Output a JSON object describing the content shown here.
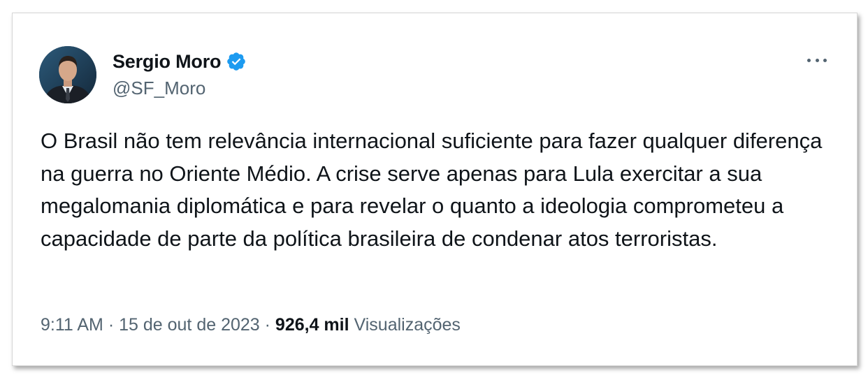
{
  "author": {
    "display_name": "Sergio Moro",
    "handle": "@SF_Moro",
    "verified": true,
    "avatar_icon": "profile-photo"
  },
  "more_icon": "more-options-icon",
  "tweet": {
    "text": "O Brasil não tem relevância internacional suficiente para fazer qualquer diferença na guerra no Oriente Médio. A crise serve apenas para Lula exercitar a sua megalomania diplomática e para revelar o quanto a ideologia comprometeu a capacidade de parte da política brasileira de condenar atos terroristas."
  },
  "meta": {
    "time": "9:11 AM",
    "separator": "·",
    "date": "15 de out de 2023",
    "views_count": "926,4 mil",
    "views_label": "Visualizações"
  },
  "colors": {
    "text_primary": "#0f1419",
    "text_secondary": "#536471",
    "verified_blue": "#1d9bf0"
  }
}
